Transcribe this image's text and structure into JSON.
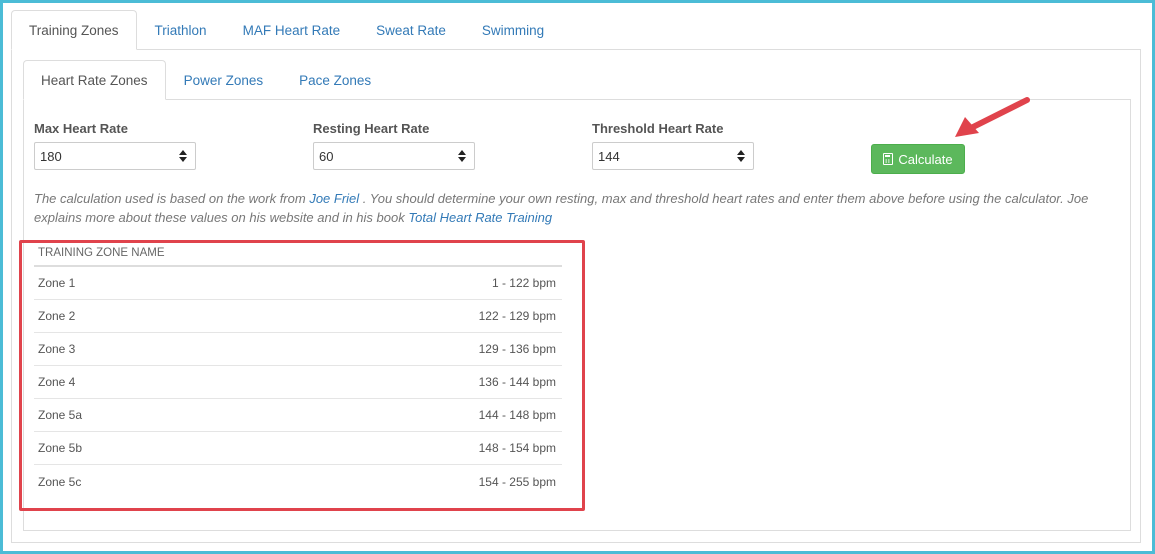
{
  "outer_tabs": [
    "Training Zones",
    "Triathlon",
    "MAF Heart Rate",
    "Sweat Rate",
    "Swimming"
  ],
  "inner_tabs": [
    "Heart Rate Zones",
    "Power Zones",
    "Pace Zones"
  ],
  "fields": {
    "max": {
      "label": "Max Heart Rate",
      "value": "180"
    },
    "resting": {
      "label": "Resting Heart Rate",
      "value": "60"
    },
    "threshold": {
      "label": "Threshold Heart Rate",
      "value": "144"
    }
  },
  "calculate_label": "Calculate",
  "description": {
    "part1": "The calculation used is based on the work from ",
    "link1": "Joe Friel",
    "part2": " . You should determine your own resting, max and threshold heart rates and enter them above before using the calculator. Joe explains more about these values on his website and in his book ",
    "link2": "Total Heart Rate Training"
  },
  "zones_header": "TRAINING ZONE NAME",
  "zones": [
    {
      "name": "Zone 1",
      "range": "1 - 122 bpm"
    },
    {
      "name": "Zone 2",
      "range": "122 - 129 bpm"
    },
    {
      "name": "Zone 3",
      "range": "129 - 136 bpm"
    },
    {
      "name": "Zone 4",
      "range": "136 - 144 bpm"
    },
    {
      "name": "Zone 5a",
      "range": "144 - 148 bpm"
    },
    {
      "name": "Zone 5b",
      "range": "148 - 154 bpm"
    },
    {
      "name": "Zone 5c",
      "range": "154 - 255 bpm"
    }
  ],
  "colors": {
    "accent_link": "#337ab7",
    "button_green": "#5cb85c",
    "annotation_red": "#e0434c",
    "frame": "#4bbcd6"
  }
}
